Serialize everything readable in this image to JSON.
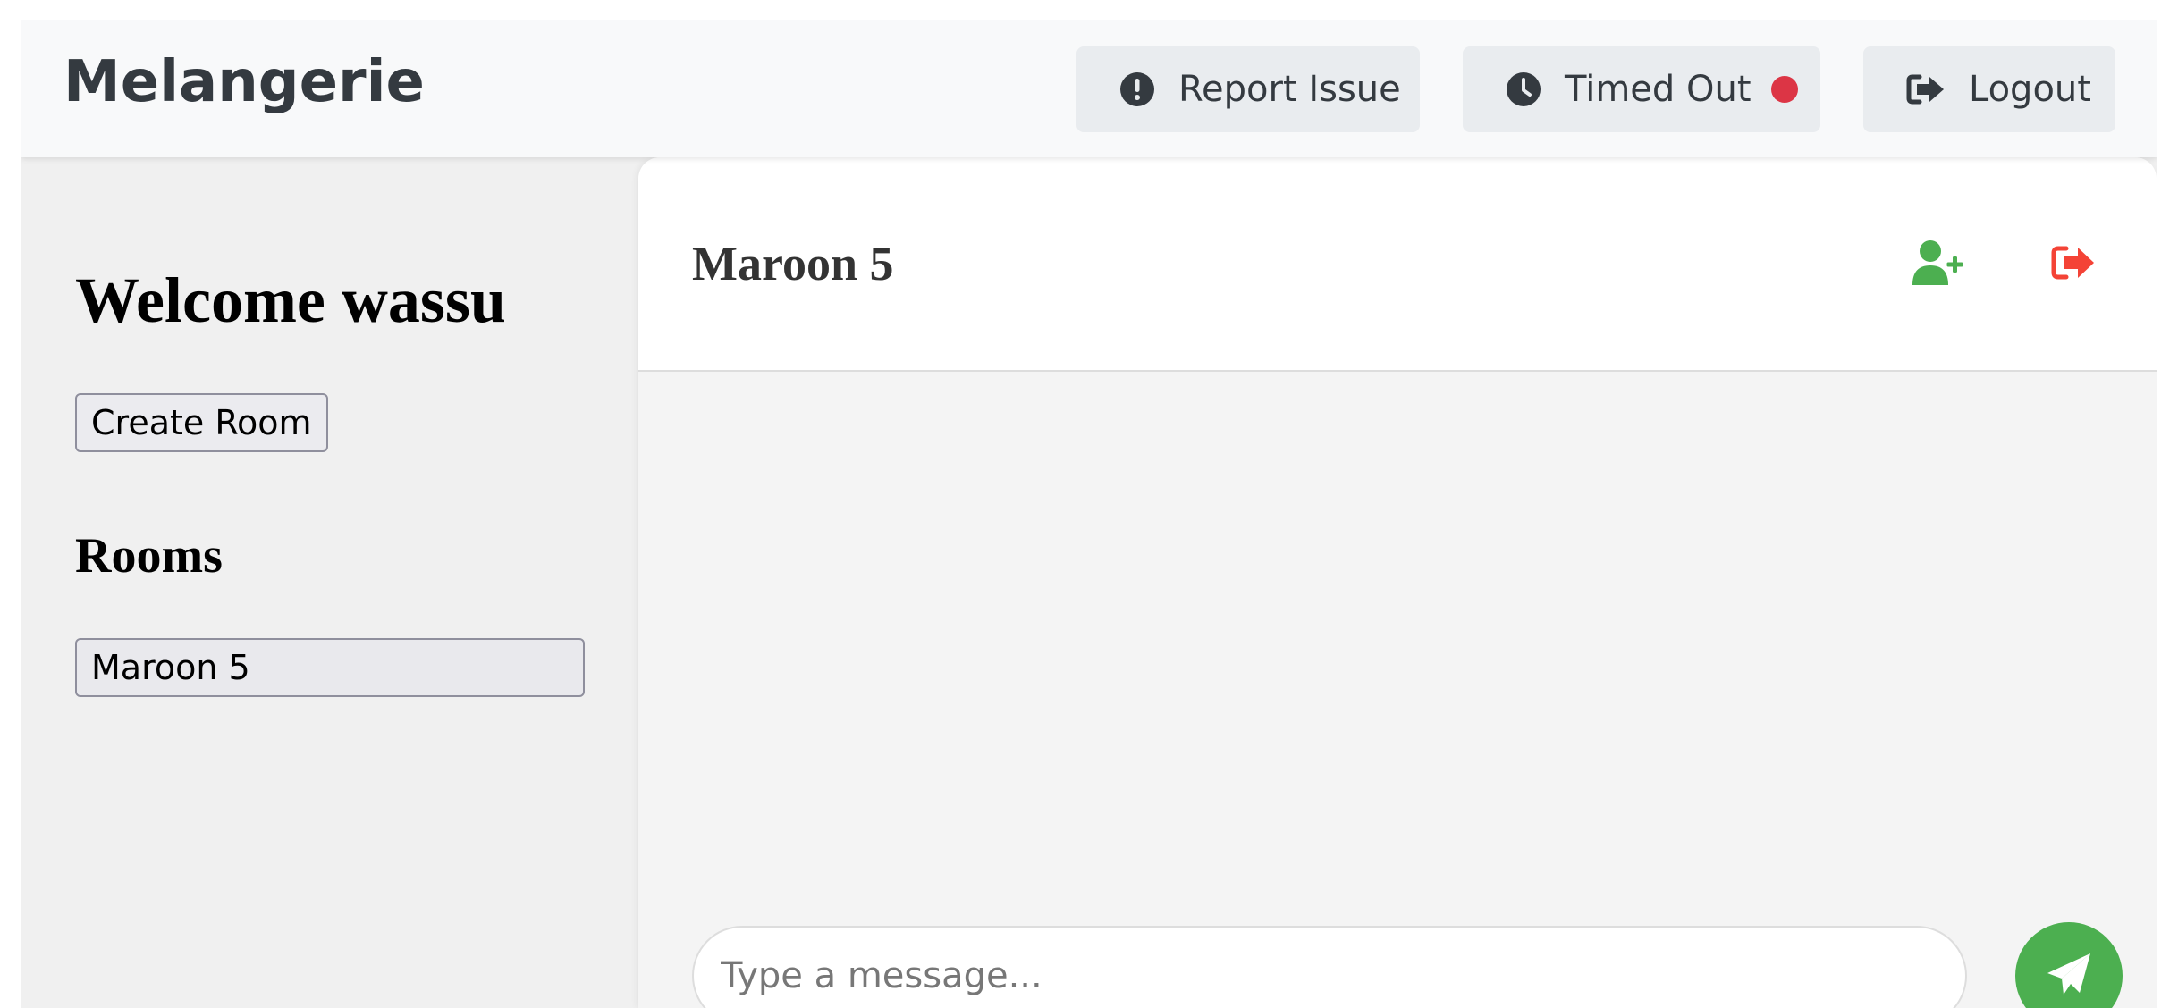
{
  "app": {
    "brand": "Melangerie"
  },
  "nav": {
    "report_label": "Report Issue",
    "report_icon": "exclamation-circle-icon",
    "timed_label": "Timed Out",
    "timed_icon": "clock-icon",
    "timed_status_color": "#dc3545",
    "logout_label": "Logout",
    "logout_icon": "sign-out-icon"
  },
  "sidebar": {
    "welcome": "Welcome wassu",
    "create_room_label": "Create Room",
    "rooms_title": "Rooms",
    "rooms": [
      {
        "name": "Maroon 5"
      }
    ]
  },
  "chat": {
    "room_title": "Maroon 5",
    "add_user_icon": "user-plus-icon",
    "add_user_color": "#4caf50",
    "leave_room_icon": "sign-out-icon",
    "leave_room_color": "#f44336",
    "message_placeholder": "Type a message...",
    "message_value": "",
    "send_icon": "paper-plane-icon",
    "send_color": "#4caf50"
  }
}
